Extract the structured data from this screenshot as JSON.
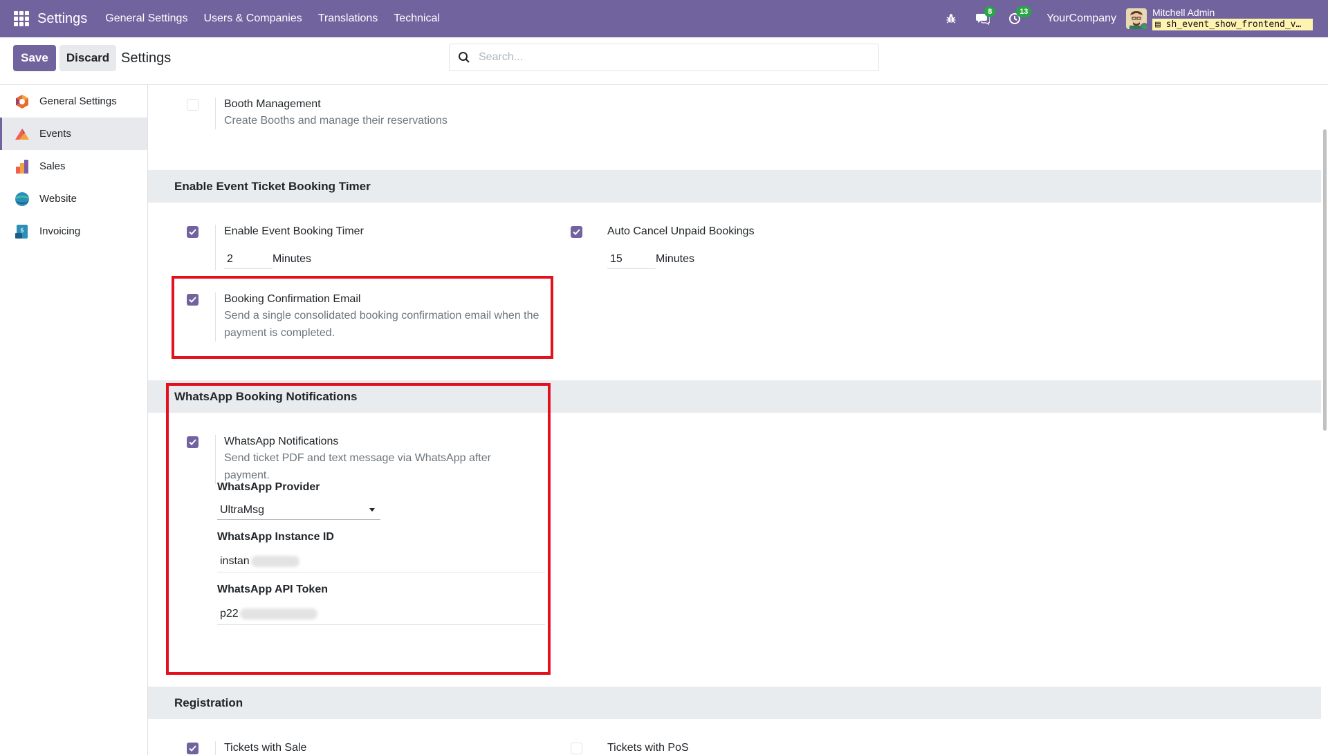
{
  "navbar": {
    "app_title": "Settings",
    "menu": [
      "General Settings",
      "Users & Companies",
      "Translations",
      "Technical"
    ],
    "messages_count": "8",
    "activities_count": "13",
    "company": "YourCompany",
    "user_name": "Mitchell Admin",
    "database": "sh_event_show_frontend_v…"
  },
  "control_panel": {
    "save_label": "Save",
    "discard_label": "Discard",
    "title": "Settings",
    "search_placeholder": "Search..."
  },
  "sidebar": {
    "items": [
      {
        "label": "General Settings",
        "icon": "odoo-icon",
        "active": false
      },
      {
        "label": "Events",
        "icon": "events-icon",
        "active": true
      },
      {
        "label": "Sales",
        "icon": "sales-icon",
        "active": false
      },
      {
        "label": "Website",
        "icon": "website-icon",
        "active": false
      },
      {
        "label": "Invoicing",
        "icon": "invoicing-icon",
        "active": false
      }
    ]
  },
  "content": {
    "booth": {
      "label": "Booth Management",
      "desc": "Create Booths and manage their reservations",
      "checked": false
    },
    "timer_section": {
      "title": "Enable Event Ticket Booking Timer",
      "timer": {
        "label": "Enable Event Booking Timer",
        "value": "2",
        "unit": "Minutes",
        "checked": true
      },
      "auto_cancel": {
        "label": "Auto Cancel Unpaid Bookings",
        "value": "15",
        "unit": "Minutes",
        "checked": true
      },
      "confirmation": {
        "label": "Booking Confirmation Email",
        "desc": "Send a single consolidated booking confirmation email when the payment is completed.",
        "checked": true
      }
    },
    "whatsapp_section": {
      "title": "WhatsApp Booking Notifications",
      "notifications": {
        "label": "WhatsApp Notifications",
        "desc": "Send ticket PDF and text message via WhatsApp after payment.",
        "checked": true
      },
      "provider_label": "WhatsApp Provider",
      "provider_value": "UltraMsg",
      "instance_label": "WhatsApp Instance ID",
      "instance_value": "instan",
      "token_label": "WhatsApp API Token",
      "token_value": "p22"
    },
    "registration_section": {
      "title": "Registration",
      "tickets_sale": {
        "label": "Tickets with Sale",
        "checked": true
      },
      "tickets_pos": {
        "label": "Tickets with PoS",
        "checked": false
      }
    }
  },
  "colors": {
    "brand": "#71639e",
    "highlight": "#e5101d",
    "badge": "#28a745"
  }
}
